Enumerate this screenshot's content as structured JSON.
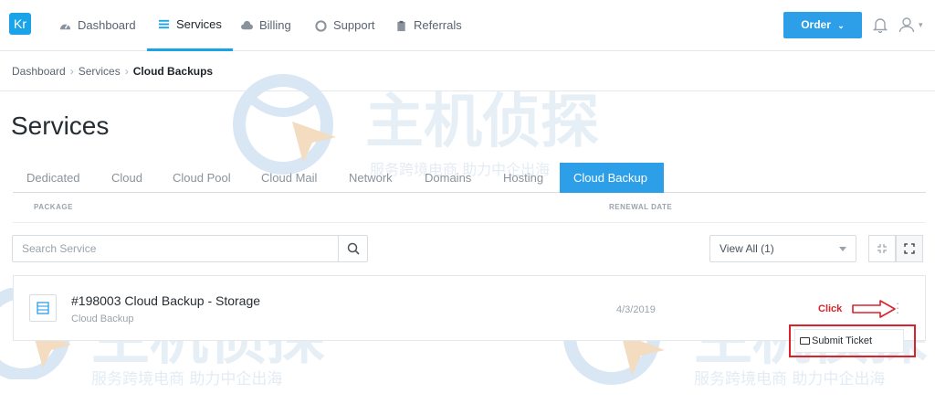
{
  "brand": {
    "logo_text": "Kr",
    "accent": "#2d9fe9"
  },
  "nav": {
    "items": [
      {
        "label": "Dashboard",
        "icon": "speedometer-icon"
      },
      {
        "label": "Services",
        "icon": "stack-icon",
        "active": true
      },
      {
        "label": "Billing",
        "icon": "cloud-icon"
      },
      {
        "label": "Support",
        "icon": "lifebuoy-icon"
      },
      {
        "label": "Referrals",
        "icon": "clipboard-icon"
      }
    ],
    "order_label": "Order"
  },
  "breadcrumb": {
    "items": [
      "Dashboard",
      "Services"
    ],
    "current": "Cloud Backups"
  },
  "page": {
    "title": "Services"
  },
  "tabs": [
    "Dedicated",
    "Cloud",
    "Cloud Pool",
    "Cloud Mail",
    "Network",
    "Domains",
    "Hosting",
    "Cloud Backup"
  ],
  "active_tab": "Cloud Backup",
  "columns": {
    "package": "PACKAGE",
    "renewal": "RENEWAL DATE"
  },
  "search": {
    "placeholder": "Search Service"
  },
  "view_filter": {
    "selected": "View All (1)"
  },
  "service": {
    "title": "#198003 Cloud Backup - Storage",
    "subtitle": "Cloud Backup",
    "renewal_date": "4/3/2019"
  },
  "menu": {
    "submit_ticket": "Submit Ticket"
  },
  "annotation": {
    "click_label": "Click"
  },
  "watermark": {
    "main": "主机侦探",
    "sub": "服务跨境电商 助力中企出海"
  }
}
